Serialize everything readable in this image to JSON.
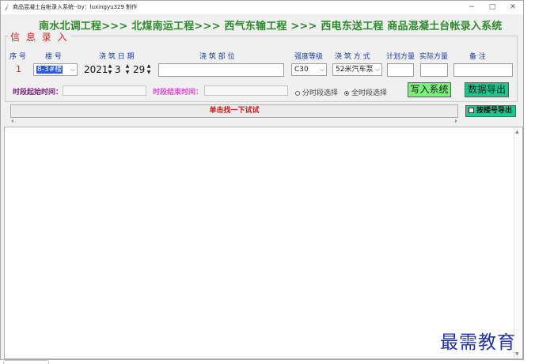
{
  "window": {
    "title": "商品混凝土台帐录入系统--by：luxingyu329 制作",
    "controls": [
      "−",
      "□",
      "✕"
    ]
  },
  "banner": "南水北调工程>>> 北煤南运工程>>> 西气东输工程 >>> 西电东送工程 商品混凝土台帐录入系统",
  "info_group": {
    "title": "信 息 录 入",
    "headers": {
      "seq": "序 号",
      "building": "楼 号",
      "date": "浇 筑 日 期",
      "part": "浇 筑 部 位",
      "grade": "强度等级",
      "method": "浇 筑 方 式",
      "planned": "计划方量",
      "actual": "实际方量",
      "remark": "备 注"
    },
    "seq_value": "1",
    "building_value": "8-3#楼",
    "date_year": "2021",
    "date_month": "3",
    "date_day": "29",
    "grade_value": "C30",
    "method_value": "52米汽车泵",
    "start_label": "时段起始时间：",
    "end_label": "时段结束时间：",
    "radio_segment": "分时段选择",
    "radio_all": "全时段选择",
    "write_button": "写入系统",
    "export_button": "数据导出"
  },
  "action_button": "单击找一下试试",
  "floor_export_check": "按楼号导出",
  "watermark": "最需教育",
  "colors": {
    "banner": "#2f8a2f",
    "group_title": "#e02020",
    "header_text": "#1a3fa0",
    "start_label": "#7a1e7a",
    "end_label": "#d050d0",
    "write_button": "#7cf07c",
    "export_button": "#22c48e",
    "watermark": "#2233aa"
  }
}
